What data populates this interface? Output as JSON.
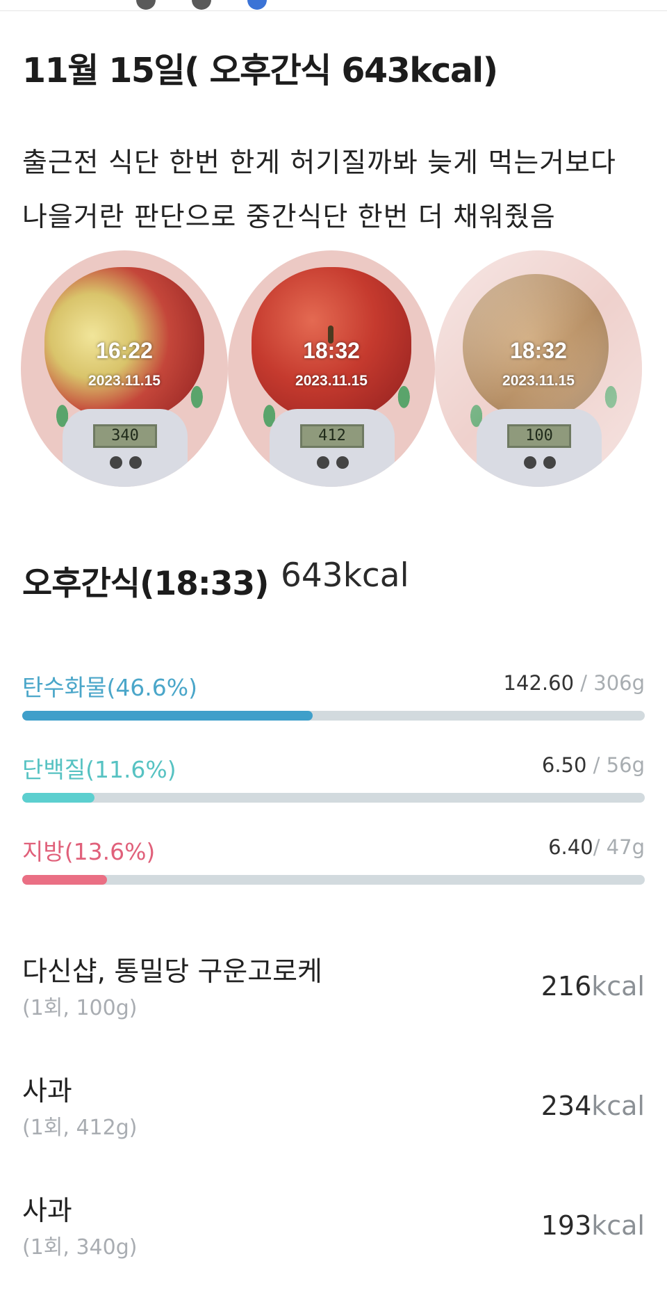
{
  "title": "11월 15일( 오후간식 643kcal)",
  "description": "출근전 식단 한번 한게 허기질까봐 늦게 먹는거보다 나을거란 판단으로 중간식단 한번 더 채워줬음",
  "photos": [
    {
      "time": "16:22",
      "date": "2023.11.15",
      "scale": "340"
    },
    {
      "time": "18:32",
      "date": "2023.11.15",
      "scale": "412"
    },
    {
      "time": "18:32",
      "date": "2023.11.15",
      "scale": "100"
    }
  ],
  "meal": {
    "name": "오후간식(18:33)",
    "kcal": "643kcal"
  },
  "macros": {
    "carb": {
      "label": "탄수화물(46.6%)",
      "value": "142.60",
      "total": " / 306g",
      "fill": 0.466
    },
    "protein": {
      "label": "단백질(11.6%)",
      "value": "6.50",
      "total": " / 56g",
      "fill": 0.116
    },
    "fat": {
      "label": "지방(13.6%)",
      "value": "6.40",
      "total": "/ 47g",
      "fill": 0.136
    }
  },
  "foods": [
    {
      "name": "다신샵, 통밀당 구운고로케",
      "serving": "(1회, 100g)",
      "kcal": "216",
      "unit": "kcal"
    },
    {
      "name": "사과",
      "serving": "(1회, 412g)",
      "kcal": "234",
      "unit": "kcal"
    },
    {
      "name": "사과",
      "serving": "(1회, 340g)",
      "kcal": "193",
      "unit": "kcal"
    }
  ],
  "colors": {
    "carb": "#3f9fca",
    "protein": "#5ccfcf",
    "fat": "#ea6f84",
    "track": "#d2dade"
  }
}
